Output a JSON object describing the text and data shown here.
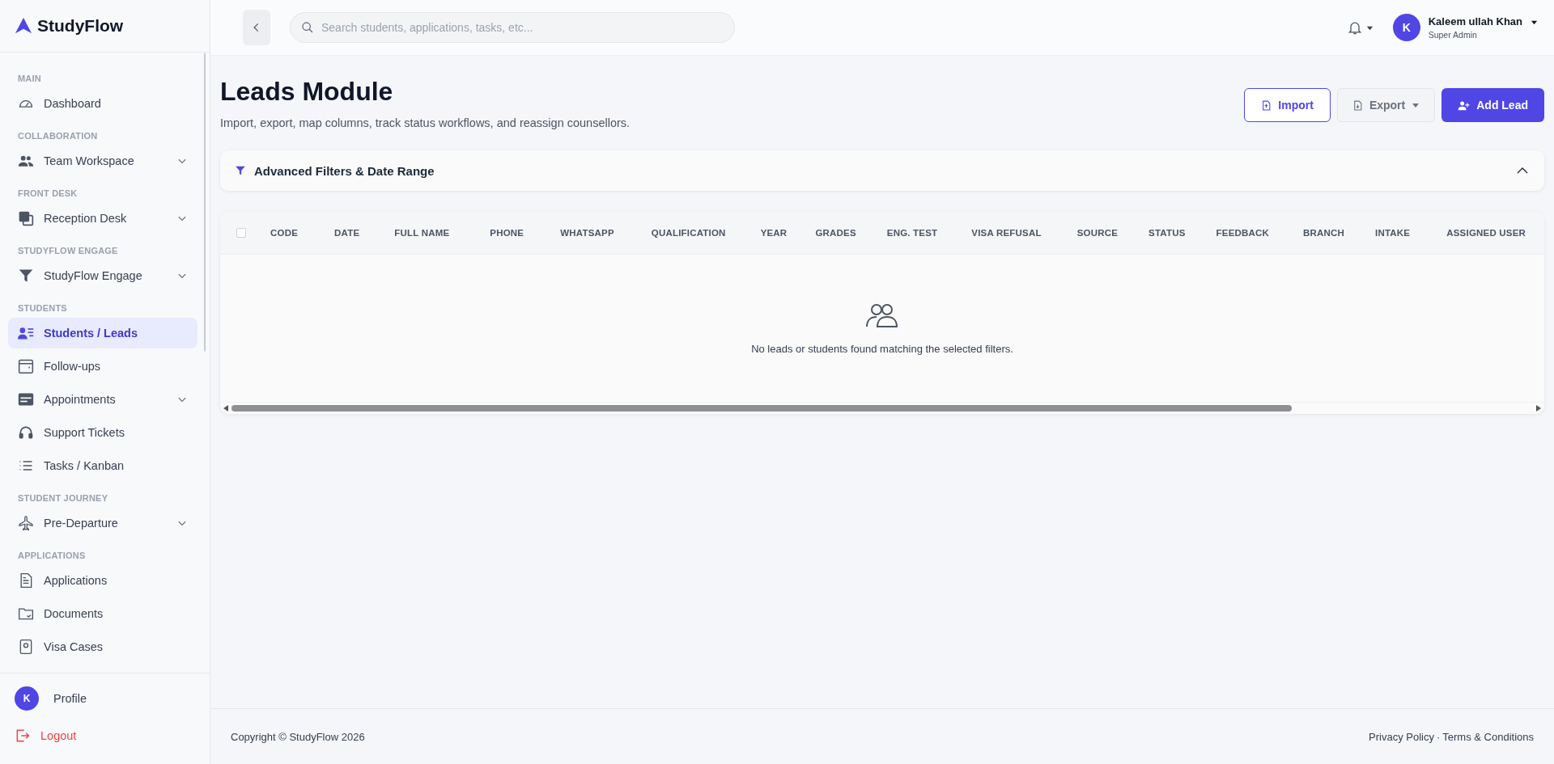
{
  "brand": {
    "name": "StudyFlow"
  },
  "sidebar": {
    "sections": [
      {
        "title": "MAIN",
        "items": [
          {
            "label": "Dashboard",
            "selected": false,
            "has_submenu": false
          }
        ]
      },
      {
        "title": "COLLABORATION",
        "items": [
          {
            "label": "Team Workspace",
            "selected": false,
            "has_submenu": true
          }
        ]
      },
      {
        "title": "FRONT DESK",
        "items": [
          {
            "label": "Reception Desk",
            "selected": false,
            "has_submenu": true
          }
        ]
      },
      {
        "title": "STUDYFLOW ENGAGE",
        "items": [
          {
            "label": "StudyFlow Engage",
            "selected": false,
            "has_submenu": true
          }
        ]
      },
      {
        "title": "STUDENTS",
        "items": [
          {
            "label": "Students / Leads",
            "selected": true,
            "has_submenu": false
          },
          {
            "label": "Follow-ups",
            "selected": false,
            "has_submenu": false
          },
          {
            "label": "Appointments",
            "selected": false,
            "has_submenu": true
          },
          {
            "label": "Support Tickets",
            "selected": false,
            "has_submenu": false
          },
          {
            "label": "Tasks / Kanban",
            "selected": false,
            "has_submenu": false
          }
        ]
      },
      {
        "title": "STUDENT JOURNEY",
        "items": [
          {
            "label": "Pre-Departure",
            "selected": false,
            "has_submenu": true
          }
        ]
      },
      {
        "title": "APPLICATIONS",
        "items": [
          {
            "label": "Applications",
            "selected": false,
            "has_submenu": false
          },
          {
            "label": "Documents",
            "selected": false,
            "has_submenu": false
          },
          {
            "label": "Visa Cases",
            "selected": false,
            "has_submenu": false
          }
        ]
      }
    ],
    "profile": {
      "initial": "K",
      "label": "Profile"
    },
    "logout": "Logout"
  },
  "topbar": {
    "search": {
      "placeholder": "Search students, applications, tasks, etc..."
    },
    "user": {
      "initial": "K",
      "name": "Kaleem ullah Khan",
      "role": "Super Admin"
    }
  },
  "page": {
    "title": "Leads Module",
    "subtitle": "Import, export, map columns, track status workflows, and reassign counsellors.",
    "buttons": [
      {
        "label": "Import",
        "kind": "outline"
      },
      {
        "label": "Export",
        "kind": "dropdown"
      },
      {
        "label": "Add Lead",
        "kind": "primary"
      }
    ]
  },
  "filters": {
    "title": "Advanced Filters & Date Range",
    "expanded": true
  },
  "table": {
    "select_all": {
      "checked": false
    },
    "columns": [
      "CODE",
      "DATE",
      "FULL NAME",
      "PHONE",
      "WHATSAPP",
      "QUALIFICATION",
      "YEAR",
      "GRADES",
      "ENG. TEST",
      "VISA REFUSAL",
      "SOURCE",
      "STATUS",
      "FEEDBACK",
      "BRANCH",
      "INTAKE",
      "ASSIGNED USER"
    ],
    "empty_message": "No leads or students found matching the selected filters."
  },
  "footer": {
    "copyright": "Copyright © StudyFlow 2026",
    "links": [
      "Privacy Policy",
      "Terms & Conditions"
    ],
    "separator": "·"
  }
}
